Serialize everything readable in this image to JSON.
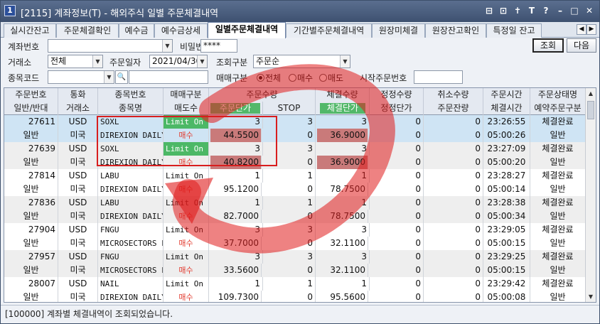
{
  "window": {
    "number": "1",
    "title": "[2115] 계좌정보(T) - 해외주식 일별 주문체결내역",
    "buttons": [
      "⊟",
      "⊡",
      "✝",
      "T",
      "?",
      "–",
      "□",
      "✕"
    ]
  },
  "tabs": [
    "실시간잔고",
    "주문체결확인",
    "예수금",
    "예수금상세",
    "일별주문체결내역",
    "기간별주문체결내역",
    "원장미체결",
    "원장잔고확인",
    "특정일 잔고"
  ],
  "tab_arrows": [
    "◀",
    "▶"
  ],
  "form": {
    "account_label": "계좌번호",
    "account_value": "",
    "password_label": "비밀번호",
    "password_value": "****",
    "exchange_label": "거래소",
    "exchange_value": "전체",
    "date_label": "주문일자",
    "date_value": "2021/04/30",
    "query_label": "조회구분",
    "query_value": "주문순",
    "code_label": "종목코드",
    "code_value": "",
    "search_icon": "🔍",
    "side_label": "매매구분",
    "side_options": [
      "전체",
      "매수",
      "매도"
    ],
    "side_selected": "전체",
    "start_order_label": "시작주문번호",
    "start_order_value": "",
    "query_button": "조회",
    "next_button": "다음",
    "dropdown_arrow": "▼"
  },
  "grid": {
    "header_top": [
      "주문번호",
      "통화",
      "종목번호",
      "매매구분",
      "주문수량",
      "",
      "체결수량",
      "정정수량",
      "취소수량",
      "주문시간",
      "주문상태명"
    ],
    "header_bottom": [
      "일반/반대",
      "거래소",
      "종목명",
      "매도수",
      "주문단가",
      "STOP",
      "체결단가",
      "정정단가",
      "주문잔량",
      "체결시간",
      "예약주문구분"
    ],
    "rows": [
      {
        "order_no": "27611",
        "currency": "USD",
        "symbol": "SOXL",
        "type": "Limit On C",
        "qty": "3",
        "qty2": "3",
        "fill_qty": "3",
        "mod_qty": "0",
        "cancel_qty": "0",
        "order_time": "23:26:55",
        "status": "체결완료",
        "kind": "일반",
        "market": "미국",
        "name": "DIREXION DAILY",
        "side": "매수",
        "price": "44.5500",
        "stop": "0",
        "fill_price": "36.9000",
        "mod_price": "0",
        "remain": "0",
        "fill_time": "05:00:26",
        "reserve": "일반"
      },
      {
        "order_no": "27639",
        "currency": "USD",
        "symbol": "SOXL",
        "type": "Limit On C",
        "qty": "3",
        "qty2": "3",
        "fill_qty": "3",
        "mod_qty": "0",
        "cancel_qty": "0",
        "order_time": "23:27:09",
        "status": "체결완료",
        "kind": "일반",
        "market": "미국",
        "name": "DIREXION DAILY",
        "side": "매수",
        "price": "40.8200",
        "stop": "0",
        "fill_price": "36.9000",
        "mod_price": "0",
        "remain": "0",
        "fill_time": "05:00:20",
        "reserve": "일반"
      },
      {
        "order_no": "27814",
        "currency": "USD",
        "symbol": "LABU",
        "type": "Limit On C",
        "qty": "1",
        "qty2": "1",
        "fill_qty": "1",
        "mod_qty": "0",
        "cancel_qty": "0",
        "order_time": "23:28:27",
        "status": "체결완료",
        "kind": "일반",
        "market": "미국",
        "name": "DIREXION DAILY",
        "side": "매수",
        "price": "95.1200",
        "stop": "0",
        "fill_price": "78.7500",
        "mod_price": "0",
        "remain": "0",
        "fill_time": "05:00:14",
        "reserve": "일반"
      },
      {
        "order_no": "27836",
        "currency": "USD",
        "symbol": "LABU",
        "type": "Limit On C",
        "qty": "1",
        "qty2": "1",
        "fill_qty": "1",
        "mod_qty": "0",
        "cancel_qty": "0",
        "order_time": "23:28:38",
        "status": "체결완료",
        "kind": "일반",
        "market": "미국",
        "name": "DIREXION DAILY",
        "side": "매수",
        "price": "82.7000",
        "stop": "0",
        "fill_price": "78.7500",
        "mod_price": "0",
        "remain": "0",
        "fill_time": "05:00:34",
        "reserve": "일반"
      },
      {
        "order_no": "27904",
        "currency": "USD",
        "symbol": "FNGU",
        "type": "Limit On C",
        "qty": "3",
        "qty2": "3",
        "fill_qty": "3",
        "mod_qty": "0",
        "cancel_qty": "0",
        "order_time": "23:29:05",
        "status": "체결완료",
        "kind": "일반",
        "market": "미국",
        "name": "MICROSECTORS F",
        "side": "매수",
        "price": "37.7000",
        "stop": "0",
        "fill_price": "32.1100",
        "mod_price": "0",
        "remain": "0",
        "fill_time": "05:00:15",
        "reserve": "일반"
      },
      {
        "order_no": "27957",
        "currency": "USD",
        "symbol": "FNGU",
        "type": "Limit On C",
        "qty": "3",
        "qty2": "3",
        "fill_qty": "3",
        "mod_qty": "0",
        "cancel_qty": "0",
        "order_time": "23:29:25",
        "status": "체결완료",
        "kind": "일반",
        "market": "미국",
        "name": "MICROSECTORS F",
        "side": "매수",
        "price": "33.5600",
        "stop": "0",
        "fill_price": "32.1100",
        "mod_price": "0",
        "remain": "0",
        "fill_time": "05:00:15",
        "reserve": "일반"
      },
      {
        "order_no": "28007",
        "currency": "USD",
        "symbol": "NAIL",
        "type": "Limit On C",
        "qty": "1",
        "qty2": "1",
        "fill_qty": "1",
        "mod_qty": "0",
        "cancel_qty": "0",
        "order_time": "23:29:42",
        "status": "체결완료",
        "kind": "일반",
        "market": "미국",
        "name": "DIREXION DAILY",
        "side": "매수",
        "price": "109.7300",
        "stop": "0",
        "fill_price": "95.5600",
        "mod_price": "0",
        "remain": "0",
        "fill_time": "05:00:08",
        "reserve": "일반"
      }
    ],
    "scroll_up": "▲",
    "scroll_down": "▼"
  },
  "status_text": "[100000] 계좌별 체결내역이 조회되었습니다."
}
